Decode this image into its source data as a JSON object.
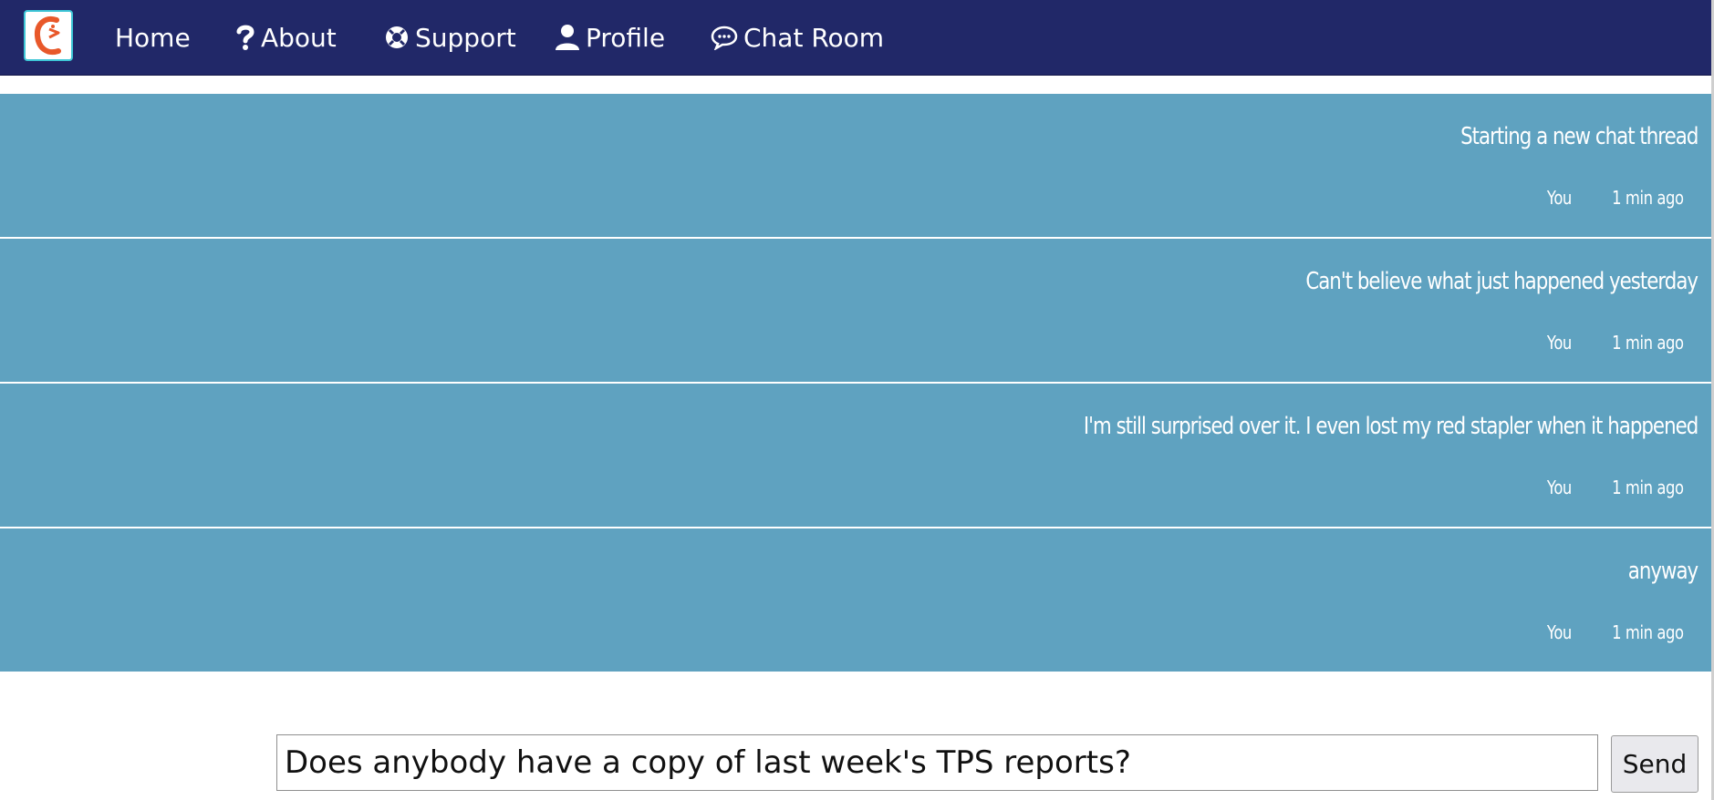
{
  "nav": {
    "logo_icon": "chat-bird-logo-icon",
    "items": [
      {
        "label": "Home",
        "icon": ""
      },
      {
        "label": "About",
        "icon": "question-icon"
      },
      {
        "label": "Support",
        "icon": "lifebuoy-icon"
      },
      {
        "label": "Profile",
        "icon": "user-icon"
      },
      {
        "label": "Chat Room",
        "icon": "chat-bubble-icon"
      }
    ]
  },
  "messages": [
    {
      "text": "Starting a new chat thread",
      "author": "You",
      "time": "1 min ago"
    },
    {
      "text": "Can't believe what just happened yesterday",
      "author": "You",
      "time": "1 min ago"
    },
    {
      "text": "I'm still surprised over it. I even lost my red stapler when it happened",
      "author": "You",
      "time": "1 min ago"
    },
    {
      "text": "anyway",
      "author": "You",
      "time": "1 min ago"
    }
  ],
  "compose": {
    "value": "Does anybody have a copy of last week's TPS reports?",
    "send_label": "Send"
  },
  "colors": {
    "navbar": "#212868",
    "message_bg": "#5fa2c0",
    "logo_accent": "#e8582a",
    "logo_border": "#3ec6d6"
  }
}
